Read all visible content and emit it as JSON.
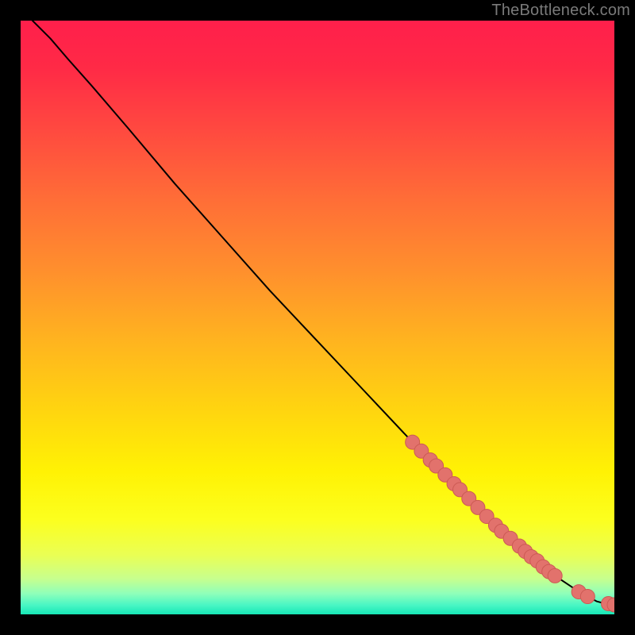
{
  "attribution": "TheBottleneck.com",
  "colors": {
    "background": "#000000",
    "attribution_text": "#7a7a7a",
    "curve_stroke": "#000000",
    "marker_fill": "#e2726c",
    "marker_stroke": "#cc5a54",
    "gradient_stops": [
      {
        "offset": 0.0,
        "color": "#ff1f4b"
      },
      {
        "offset": 0.08,
        "color": "#ff2a46"
      },
      {
        "offset": 0.18,
        "color": "#ff4840"
      },
      {
        "offset": 0.3,
        "color": "#ff6d37"
      },
      {
        "offset": 0.42,
        "color": "#ff8f2d"
      },
      {
        "offset": 0.54,
        "color": "#ffb41f"
      },
      {
        "offset": 0.66,
        "color": "#ffd60f"
      },
      {
        "offset": 0.76,
        "color": "#fff204"
      },
      {
        "offset": 0.84,
        "color": "#fcff1e"
      },
      {
        "offset": 0.9,
        "color": "#eaff54"
      },
      {
        "offset": 0.94,
        "color": "#c7ff8e"
      },
      {
        "offset": 0.965,
        "color": "#8fffba"
      },
      {
        "offset": 0.985,
        "color": "#47f6c4"
      },
      {
        "offset": 1.0,
        "color": "#17e6b6"
      }
    ]
  },
  "chart_data": {
    "type": "line",
    "title": "",
    "xlabel": "",
    "ylabel": "",
    "xlim": [
      0,
      100
    ],
    "ylim": [
      0,
      100
    ],
    "grid": false,
    "legend": false,
    "series": [
      {
        "name": "curve",
        "x": [
          2,
          5,
          8,
          12,
          18,
          26,
          34,
          42,
          50,
          58,
          66,
          72,
          78,
          83,
          87,
          90,
          93,
          95.5,
          97,
          98.5,
          100
        ],
        "y": [
          100,
          97,
          93.5,
          89,
          82,
          72.5,
          63.5,
          54.5,
          46,
          37.5,
          29,
          23,
          17,
          12.5,
          9,
          6.5,
          4.5,
          3,
          2.2,
          1.8,
          1.6
        ]
      }
    ],
    "markers": {
      "name": "highlighted-points",
      "series": "curve",
      "points": [
        {
          "x": 66.0,
          "y": 29.0
        },
        {
          "x": 67.5,
          "y": 27.5
        },
        {
          "x": 69.0,
          "y": 26.0
        },
        {
          "x": 70.0,
          "y": 25.0
        },
        {
          "x": 71.5,
          "y": 23.5
        },
        {
          "x": 73.0,
          "y": 22.0
        },
        {
          "x": 74.0,
          "y": 21.0
        },
        {
          "x": 75.5,
          "y": 19.5
        },
        {
          "x": 77.0,
          "y": 18.0
        },
        {
          "x": 78.5,
          "y": 16.5
        },
        {
          "x": 80.0,
          "y": 15.0
        },
        {
          "x": 81.0,
          "y": 14.0
        },
        {
          "x": 82.5,
          "y": 12.8
        },
        {
          "x": 84.0,
          "y": 11.5
        },
        {
          "x": 85.0,
          "y": 10.6
        },
        {
          "x": 86.0,
          "y": 9.7
        },
        {
          "x": 87.0,
          "y": 9.0
        },
        {
          "x": 88.0,
          "y": 8.0
        },
        {
          "x": 89.0,
          "y": 7.2
        },
        {
          "x": 90.0,
          "y": 6.5
        },
        {
          "x": 94.0,
          "y": 3.8
        },
        {
          "x": 95.5,
          "y": 3.0
        },
        {
          "x": 99.0,
          "y": 1.8
        },
        {
          "x": 100.0,
          "y": 1.6
        }
      ]
    }
  }
}
